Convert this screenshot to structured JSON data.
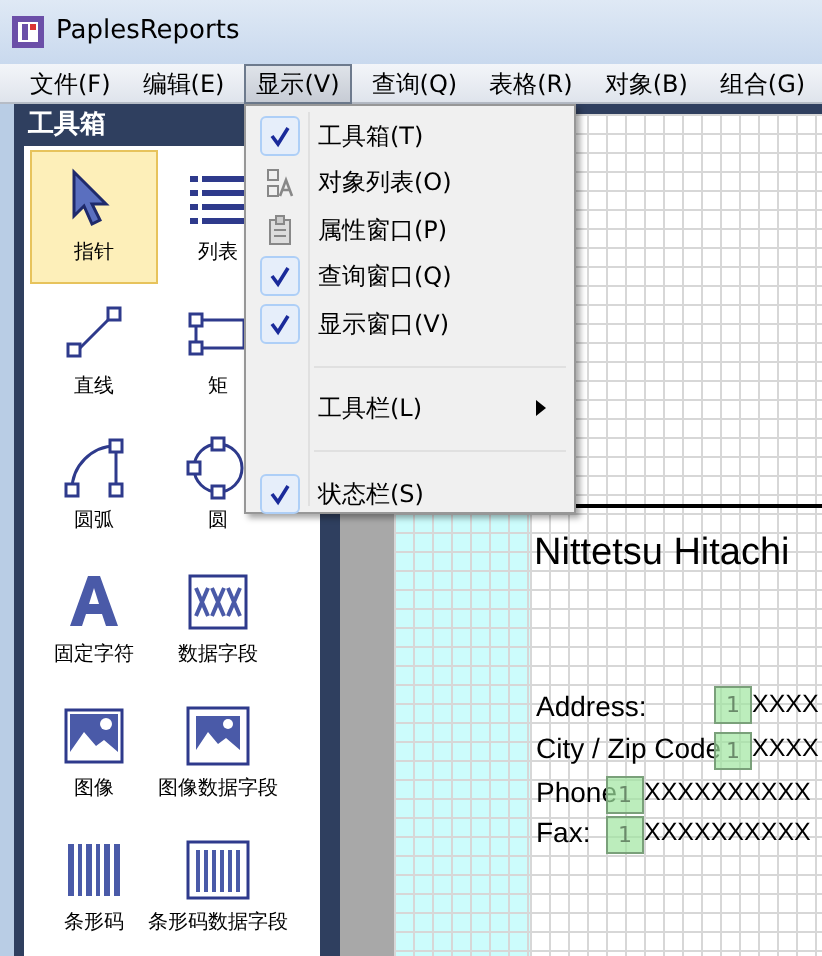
{
  "window": {
    "title": "PaplesReports"
  },
  "menu_bar": [
    {
      "label": "文件(F)",
      "selected": false
    },
    {
      "label": "编辑(E)",
      "selected": false
    },
    {
      "label": "显示(V)",
      "selected": true
    },
    {
      "label": "查询(Q)",
      "selected": false
    },
    {
      "label": "表格(R)",
      "selected": false
    },
    {
      "label": "对象(B)",
      "selected": false
    },
    {
      "label": "组合(G)",
      "selected": false
    }
  ],
  "toolbox": {
    "title": "工具箱",
    "items": [
      {
        "label": "指针",
        "kind": "pointer",
        "selected": true
      },
      {
        "label": "列表",
        "kind": "list",
        "selected": false
      },
      {
        "label": "直线",
        "kind": "line",
        "selected": false
      },
      {
        "label": "矩",
        "kind": "rect",
        "selected": false
      },
      {
        "label": "圆弧",
        "kind": "arc",
        "selected": false
      },
      {
        "label": "圆",
        "kind": "circle",
        "selected": false
      },
      {
        "label": "固定字符",
        "kind": "text",
        "selected": false
      },
      {
        "label": "数据字段",
        "kind": "field",
        "selected": false
      },
      {
        "label": "图像",
        "kind": "image",
        "selected": false
      },
      {
        "label": "图像数据字段",
        "kind": "imagefield",
        "selected": false
      },
      {
        "label": "条形码",
        "kind": "barcode",
        "selected": false
      },
      {
        "label": "条形码数据字段",
        "kind": "barcodefield",
        "selected": false
      }
    ]
  },
  "view_menu": [
    {
      "label": "工具箱(T)",
      "kind": "toggle",
      "checked": true
    },
    {
      "label": "对象列表(O)",
      "kind": "objects"
    },
    {
      "label": "属性窗口(P)",
      "kind": "properties"
    },
    {
      "label": "查询窗口(Q)",
      "kind": "toggle",
      "checked": true
    },
    {
      "label": "显示窗口(V)",
      "kind": "toggle",
      "checked": true
    },
    {
      "kind": "separator"
    },
    {
      "label": "工具栏(L)",
      "kind": "submenu"
    },
    {
      "kind": "separator"
    },
    {
      "label": "状态栏(S)",
      "kind": "toggle",
      "checked": true
    }
  ],
  "report": {
    "title": "Nittetsu Hitachi",
    "fields": [
      {
        "label": "Address:",
        "marker": "1",
        "value": "XXXX"
      },
      {
        "label": "City / Zip Code",
        "marker": "1",
        "value": "XXXX"
      },
      {
        "label": "Phone",
        "marker": "1",
        "value": "XXXXXXXXXX"
      },
      {
        "label": "Fax:",
        "marker": "1",
        "value": "XXXXXXXXXX"
      }
    ]
  }
}
